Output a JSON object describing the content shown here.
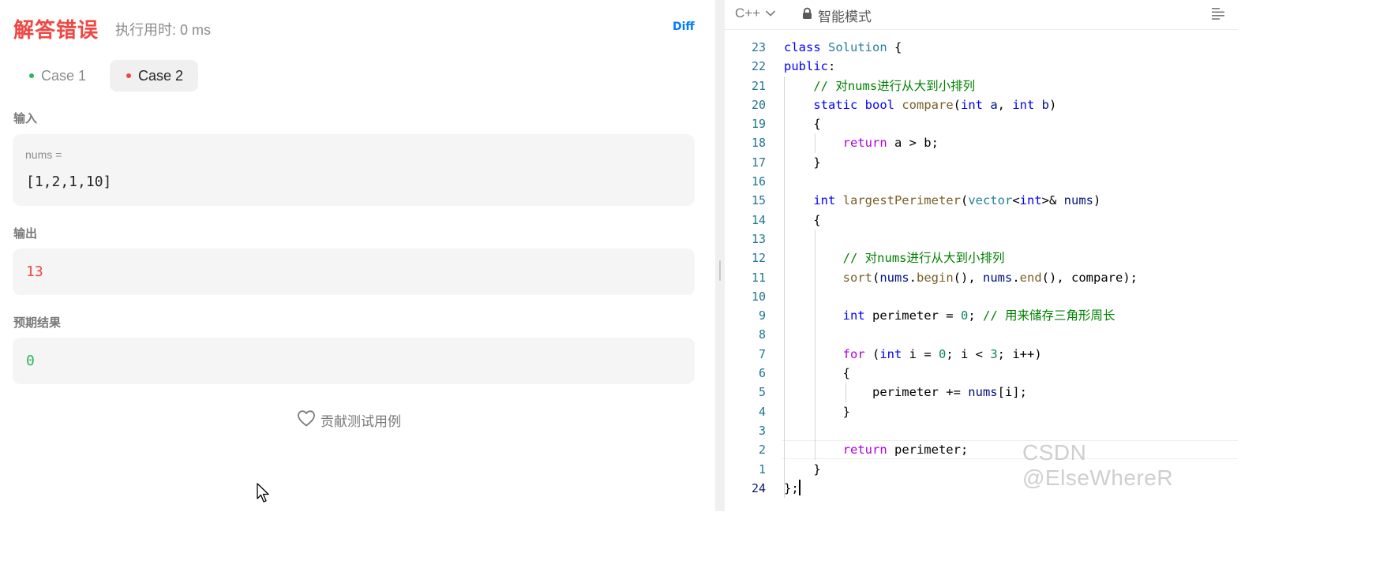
{
  "result": {
    "title": "解答错误",
    "runtime": "执行用时: 0 ms",
    "diff_label": "Diff"
  },
  "cases": [
    {
      "label": "Case 1",
      "status_color": "#2db55d",
      "active": false
    },
    {
      "label": "Case 2",
      "status_color": "#ef4743",
      "active": true
    }
  ],
  "input": {
    "label": "输入",
    "var_name": "nums =",
    "value": "[1,2,1,10]"
  },
  "output": {
    "label": "输出",
    "value": "13",
    "color": "#ef4743"
  },
  "expected": {
    "label": "预期结果",
    "value": "0",
    "color": "#2db55d"
  },
  "contribute_label": "贡献测试用例",
  "editor": {
    "language": "C++",
    "mode": "智能模式",
    "code_lines": [
      {
        "ln": "23",
        "tokens": [
          {
            "t": "class ",
            "c": "k-blue"
          },
          {
            "t": "Solution",
            "c": "k-teal"
          },
          {
            "t": " {"
          }
        ]
      },
      {
        "ln": "22",
        "tokens": [
          {
            "t": "public",
            "c": "k-blue"
          },
          {
            "t": ":"
          }
        ]
      },
      {
        "ln": "21",
        "tokens": [
          {
            "t": "    "
          },
          {
            "t": "// 对nums进行从大到小排列",
            "c": "k-cmt"
          }
        ]
      },
      {
        "ln": "20",
        "tokens": [
          {
            "t": "    "
          },
          {
            "t": "static ",
            "c": "k-blue"
          },
          {
            "t": "bool ",
            "c": "k-blue"
          },
          {
            "t": "compare",
            "c": "k-fn"
          },
          {
            "t": "("
          },
          {
            "t": "int ",
            "c": "k-blue"
          },
          {
            "t": "a",
            "c": "k-var"
          },
          {
            "t": ", "
          },
          {
            "t": "int ",
            "c": "k-blue"
          },
          {
            "t": "b",
            "c": "k-var"
          },
          {
            "t": ")"
          }
        ]
      },
      {
        "ln": "19",
        "tokens": [
          {
            "t": "    {"
          }
        ]
      },
      {
        "ln": "18",
        "tokens": [
          {
            "t": "        "
          },
          {
            "t": "return ",
            "c": "k-purple"
          },
          {
            "t": "a > b;"
          }
        ]
      },
      {
        "ln": "17",
        "tokens": [
          {
            "t": "    }"
          }
        ]
      },
      {
        "ln": "16",
        "tokens": []
      },
      {
        "ln": "15",
        "tokens": [
          {
            "t": "    "
          },
          {
            "t": "int ",
            "c": "k-blue"
          },
          {
            "t": "largestPerimeter",
            "c": "k-fn"
          },
          {
            "t": "("
          },
          {
            "t": "vector",
            "c": "k-teal"
          },
          {
            "t": "<"
          },
          {
            "t": "int",
            "c": "k-blue"
          },
          {
            "t": ">& "
          },
          {
            "t": "nums",
            "c": "k-var"
          },
          {
            "t": ")"
          }
        ]
      },
      {
        "ln": "14",
        "tokens": [
          {
            "t": "    {"
          }
        ]
      },
      {
        "ln": "13",
        "tokens": []
      },
      {
        "ln": "12",
        "tokens": [
          {
            "t": "        "
          },
          {
            "t": "// 对nums进行从大到小排列",
            "c": "k-cmt"
          }
        ]
      },
      {
        "ln": "11",
        "tokens": [
          {
            "t": "        "
          },
          {
            "t": "sort",
            "c": "k-fn"
          },
          {
            "t": "("
          },
          {
            "t": "nums",
            "c": "k-var"
          },
          {
            "t": "."
          },
          {
            "t": "begin",
            "c": "k-fn"
          },
          {
            "t": "(), "
          },
          {
            "t": "nums",
            "c": "k-var"
          },
          {
            "t": "."
          },
          {
            "t": "end",
            "c": "k-fn"
          },
          {
            "t": "(), compare);"
          }
        ]
      },
      {
        "ln": "10",
        "tokens": []
      },
      {
        "ln": "9",
        "tokens": [
          {
            "t": "        "
          },
          {
            "t": "int ",
            "c": "k-blue"
          },
          {
            "t": "perimeter = "
          },
          {
            "t": "0",
            "c": "k-num"
          },
          {
            "t": "; "
          },
          {
            "t": "// 用来储存三角形周长",
            "c": "k-cmt"
          }
        ]
      },
      {
        "ln": "8",
        "tokens": []
      },
      {
        "ln": "7",
        "tokens": [
          {
            "t": "        "
          },
          {
            "t": "for ",
            "c": "k-purple"
          },
          {
            "t": "("
          },
          {
            "t": "int ",
            "c": "k-blue"
          },
          {
            "t": "i = "
          },
          {
            "t": "0",
            "c": "k-num"
          },
          {
            "t": "; i < "
          },
          {
            "t": "3",
            "c": "k-num"
          },
          {
            "t": "; i++)"
          }
        ]
      },
      {
        "ln": "6",
        "tokens": [
          {
            "t": "        {"
          }
        ]
      },
      {
        "ln": "5",
        "tokens": [
          {
            "t": "            perimeter += "
          },
          {
            "t": "nums",
            "c": "k-var"
          },
          {
            "t": "[i];"
          }
        ]
      },
      {
        "ln": "4",
        "tokens": [
          {
            "t": "        }"
          }
        ]
      },
      {
        "ln": "3",
        "tokens": []
      },
      {
        "ln": "2",
        "tokens": [
          {
            "t": "        "
          },
          {
            "t": "return ",
            "c": "k-purple"
          },
          {
            "t": "perimeter;"
          }
        ]
      },
      {
        "ln": "1",
        "tokens": [
          {
            "t": "    }"
          }
        ]
      },
      {
        "ln": "24",
        "tokens": [
          {
            "t": "};"
          }
        ],
        "current": true
      }
    ]
  },
  "watermark": "CSDN @ElseWhereR"
}
